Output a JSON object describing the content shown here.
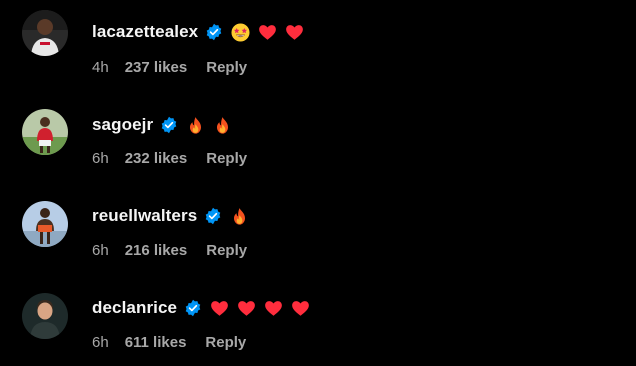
{
  "comments": [
    {
      "username": "lacazettealex",
      "verified": true,
      "emojis": [
        "star-struck-emoji",
        "red-heart-emoji",
        "red-heart-emoji"
      ],
      "time": "4h",
      "likes": "237 likes",
      "reply": "Reply"
    },
    {
      "username": "sagoejr",
      "verified": true,
      "emojis": [
        "fire-emoji",
        "fire-emoji"
      ],
      "time": "6h",
      "likes": "232 likes",
      "reply": "Reply"
    },
    {
      "username": "reuellwalters",
      "verified": true,
      "emojis": [
        "fire-emoji"
      ],
      "time": "6h",
      "likes": "216 likes",
      "reply": "Reply"
    },
    {
      "username": "declanrice",
      "verified": true,
      "emojis": [
        "red-heart-emoji",
        "red-heart-emoji",
        "red-heart-emoji",
        "red-heart-emoji"
      ],
      "time": "6h",
      "likes": "611 likes",
      "reply": "Reply"
    }
  ],
  "colors": {
    "background": "#000000",
    "text_primary": "#f5f5f5",
    "text_secondary": "#a8a8a8",
    "verified_blue": "#0095f6",
    "heart_red": "#ff2d3d"
  }
}
